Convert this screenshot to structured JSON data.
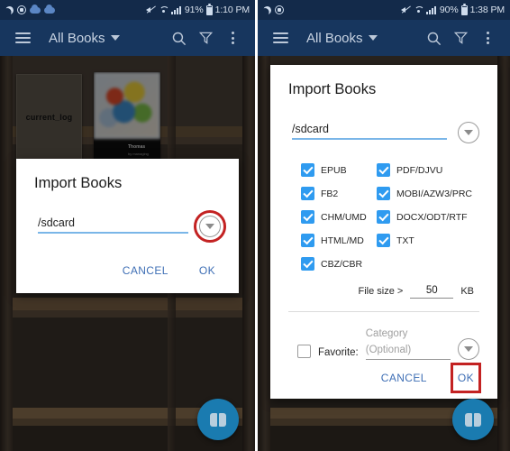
{
  "left_panel": {
    "status_bar": {
      "icons_left": [
        "moon-icon",
        "screen-record-icon",
        "cloud-icon",
        "cloud-icon"
      ],
      "icons_right": [
        "mute-icon",
        "wifi-icon",
        "signal-icon",
        "battery-icon"
      ],
      "battery": "91%",
      "time": "1:10 PM"
    },
    "toolbar": {
      "menu_icon": "hamburger-menu-icon",
      "title": "All Books",
      "search_icon": "search-icon",
      "filter_icon": "funnel-filter-icon",
      "overflow_icon": "overflow-menu-icon"
    },
    "shelf": {
      "item1_label": "current_log",
      "item2_title": "Thomas",
      "item2_subtitle": "by managing"
    },
    "dialog": {
      "title": "Import Books",
      "path_value": "/sdcard",
      "dropdown_icon": "chevron-down-circle-icon",
      "cancel_label": "CANCEL",
      "ok_label": "OK",
      "highlight": "dropdown-button"
    },
    "fab": {
      "icon": "open-book-icon"
    }
  },
  "right_panel": {
    "status_bar": {
      "icons_left": [
        "moon-icon",
        "screen-record-icon"
      ],
      "icons_right": [
        "mute-icon",
        "wifi-icon",
        "signal-icon",
        "battery-icon"
      ],
      "battery": "90%",
      "time": "1:38 PM"
    },
    "toolbar": {
      "menu_icon": "hamburger-menu-icon",
      "title": "All Books",
      "search_icon": "search-icon",
      "filter_icon": "funnel-filter-icon",
      "overflow_icon": "overflow-menu-icon"
    },
    "dialog": {
      "title": "Import Books",
      "path_value": "/sdcard",
      "dropdown_icon": "chevron-down-circle-icon",
      "formats": [
        {
          "label": "EPUB",
          "checked": true
        },
        {
          "label": "PDF/DJVU",
          "checked": true
        },
        {
          "label": "FB2",
          "checked": true
        },
        {
          "label": "MOBI/AZW3/PRC",
          "checked": true
        },
        {
          "label": "CHM/UMD",
          "checked": true
        },
        {
          "label": "DOCX/ODT/RTF",
          "checked": true
        },
        {
          "label": "HTML/MD",
          "checked": true
        },
        {
          "label": "TXT",
          "checked": true
        },
        {
          "label": "CBZ/CBR",
          "checked": true
        }
      ],
      "file_size_label": "File size >",
      "file_size_value": "50",
      "file_size_unit": "KB",
      "favorite_checked": false,
      "favorite_label": "Favorite:",
      "category_placeholder": "Category (Optional)",
      "category_dropdown_icon": "chevron-down-circle-icon",
      "cancel_label": "CANCEL",
      "ok_label": "OK",
      "highlight": "ok-button"
    },
    "fab": {
      "icon": "open-book-icon"
    }
  },
  "colors": {
    "statusbar": "#132a4a",
    "toolbar": "#17365e",
    "accent_checkbox": "#2f9bf0",
    "underline": "#7ab6e8",
    "text_button": "#3f6fb5",
    "highlight_red": "#c32222",
    "fab": "#1a7bb0"
  }
}
